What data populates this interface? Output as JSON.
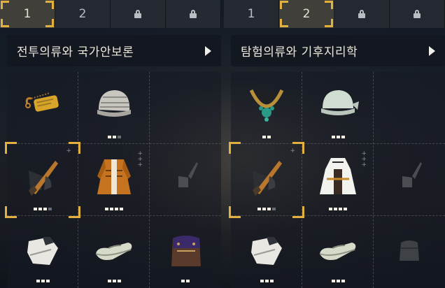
{
  "left_panel": {
    "tabs": [
      {
        "label": "1",
        "state": "active"
      },
      {
        "label": "2",
        "state": "normal"
      },
      {
        "label": "",
        "state": "locked"
      },
      {
        "label": "",
        "state": "locked"
      }
    ],
    "title": "전투의류와 국가안보론",
    "slots": [
      {
        "item": "dog-tag-icon",
        "level": 0
      },
      {
        "item": "knit-cap-icon",
        "level": 2,
        "max": 3
      },
      {
        "item": "empty",
        "level": 0
      },
      {
        "item": "knife-glove-icon",
        "level": 3,
        "max": 4,
        "selected": true
      },
      {
        "item": "orange-coat-icon",
        "level": 4,
        "max": 4
      },
      {
        "item": "knife-glove-faded-icon",
        "level": 0
      },
      {
        "item": "fingerless-glove-icon",
        "level": 3,
        "max": 3
      },
      {
        "item": "moccasin-icon",
        "level": 3,
        "max": 3
      },
      {
        "item": "backpack-icon",
        "level": 2,
        "max": 2
      }
    ]
  },
  "right_panel": {
    "tabs": [
      {
        "label": "1",
        "state": "normal"
      },
      {
        "label": "2",
        "state": "active"
      },
      {
        "label": "",
        "state": "locked"
      },
      {
        "label": "",
        "state": "locked"
      }
    ],
    "title": "탐험의류와 기후지리학",
    "slots": [
      {
        "item": "amulet-necklace-icon",
        "level": 2,
        "max": 2
      },
      {
        "item": "bandana-icon",
        "level": 3,
        "max": 3
      },
      {
        "item": "empty",
        "level": 0
      },
      {
        "item": "knife-glove-icon",
        "level": 3,
        "max": 4,
        "selected": true
      },
      {
        "item": "white-robe-icon",
        "level": 4,
        "max": 4
      },
      {
        "item": "knife-glove-faded-icon",
        "level": 0
      },
      {
        "item": "fingerless-glove-icon",
        "level": 3,
        "max": 3
      },
      {
        "item": "moccasin-icon",
        "level": 3,
        "max": 3
      },
      {
        "item": "bag-faded-icon",
        "level": 0
      }
    ]
  },
  "colors": {
    "accent": "#e2b040",
    "text": "#ece8de"
  }
}
